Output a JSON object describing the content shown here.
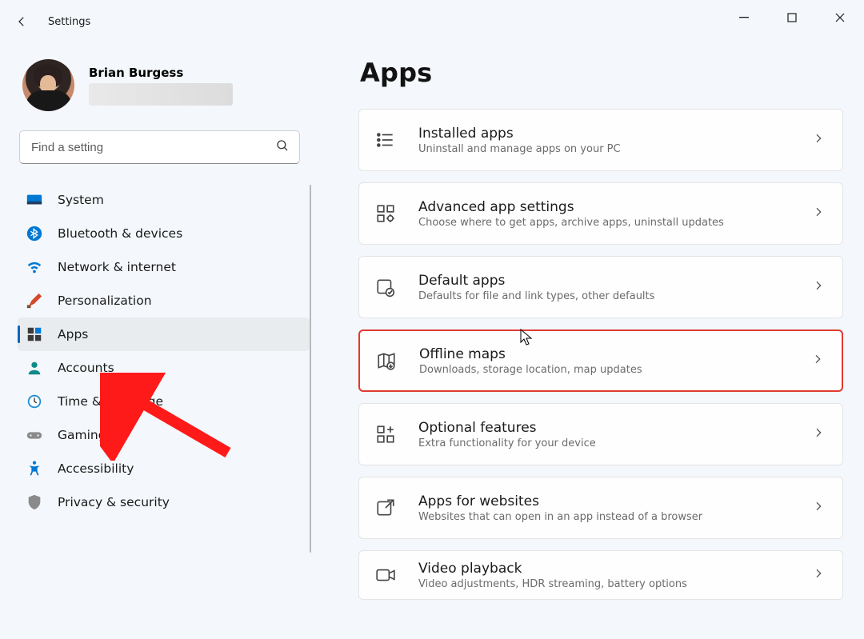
{
  "window": {
    "app_title": "Settings",
    "minimize": "−",
    "maximize": "▢",
    "close": "✕"
  },
  "profile": {
    "display_name": "Brian Burgess"
  },
  "search": {
    "placeholder": "Find a setting"
  },
  "nav": [
    {
      "id": "system",
      "label": "System",
      "icon": "system"
    },
    {
      "id": "bluetooth",
      "label": "Bluetooth & devices",
      "icon": "bluetooth"
    },
    {
      "id": "network",
      "label": "Network & internet",
      "icon": "wifi"
    },
    {
      "id": "personalization",
      "label": "Personalization",
      "icon": "brush"
    },
    {
      "id": "apps",
      "label": "Apps",
      "icon": "apps",
      "active": true
    },
    {
      "id": "accounts",
      "label": "Accounts",
      "icon": "person"
    },
    {
      "id": "time",
      "label": "Time & language",
      "icon": "clock"
    },
    {
      "id": "gaming",
      "label": "Gaming",
      "icon": "gamepad"
    },
    {
      "id": "accessibility",
      "label": "Accessibility",
      "icon": "accessibility"
    },
    {
      "id": "privacy",
      "label": "Privacy & security",
      "icon": "shield"
    }
  ],
  "main": {
    "title": "Apps",
    "cards": [
      {
        "id": "installed",
        "title": "Installed apps",
        "subtitle": "Uninstall and manage apps on your PC",
        "icon": "list"
      },
      {
        "id": "advanced",
        "title": "Advanced app settings",
        "subtitle": "Choose where to get apps, archive apps, uninstall updates",
        "icon": "gear-grid"
      },
      {
        "id": "default",
        "title": "Default apps",
        "subtitle": "Defaults for file and link types, other defaults",
        "icon": "default-apps"
      },
      {
        "id": "offline",
        "title": "Offline maps",
        "subtitle": "Downloads, storage location, map updates",
        "icon": "map",
        "highlight": true,
        "cursor": true
      },
      {
        "id": "optional",
        "title": "Optional features",
        "subtitle": "Extra functionality for your device",
        "icon": "grid-plus"
      },
      {
        "id": "websites",
        "title": "Apps for websites",
        "subtitle": "Websites that can open in an app instead of a browser",
        "icon": "launch"
      },
      {
        "id": "video",
        "title": "Video playback",
        "subtitle": "Video adjustments, HDR streaming, battery options",
        "icon": "video"
      }
    ]
  }
}
